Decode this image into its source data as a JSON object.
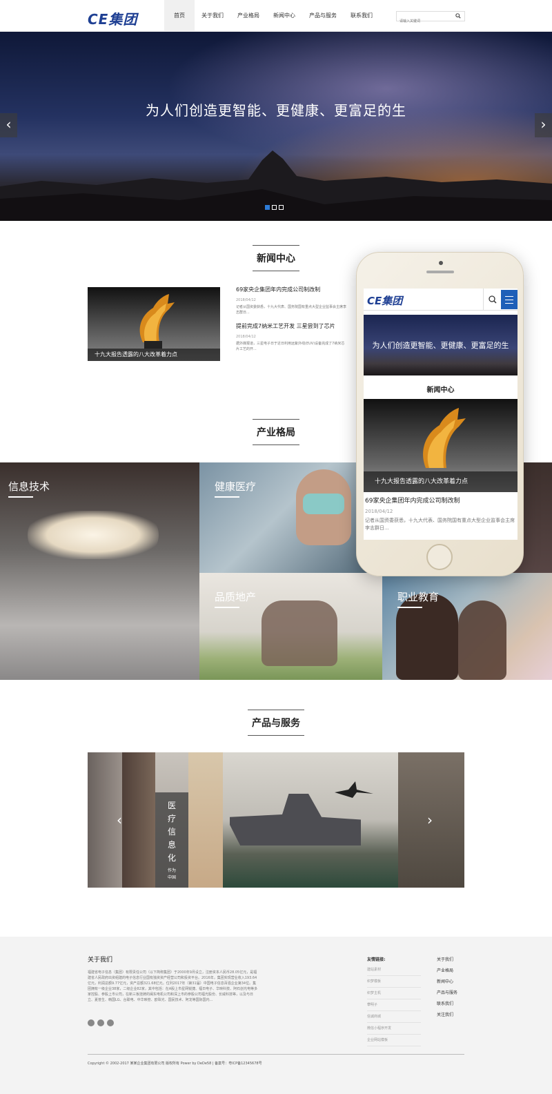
{
  "header": {
    "logo": "CE集团",
    "nav": [
      "首页",
      "关于我们",
      "产业格局",
      "新闻中心",
      "产品与服务",
      "联系我们"
    ],
    "search_placeholder": "请输入关键词"
  },
  "banner": {
    "title": "为人们创造更智能、更健康、更富足的生",
    "prev": "‹",
    "next": "›",
    "slides": 3,
    "active_slide": 1
  },
  "news": {
    "title": "新闻中心",
    "image_caption": "十九大报告透露的八大改革着力点",
    "items": [
      {
        "title": "69家央企集团年内完成公司制改制",
        "date": "2018/04/12",
        "summary": "记者从国资委获悉，十九大代表、国务院国有重点大型企业监事会主席李志群日..."
      },
      {
        "title": "提前完成7纳米工艺开发 三星尝到了芯片",
        "date": "2018/04/12",
        "summary": "据外媒报道，三星电子日于近日利用远紫外线(EUV)设备完成了7纳米芯片工艺的开..."
      }
    ]
  },
  "industry": {
    "title": "产业格局",
    "tiles": [
      "信息技术",
      "健康医疗",
      "品质地产",
      "职业教育"
    ]
  },
  "phone": {
    "logo": "CE集团",
    "banner_title": "为人们创造更智能、更健康、更富足的生",
    "section": "新闻中心",
    "caption": "十九大报告透露的八大改革着力点",
    "news_title": "69家央企集团年内完成公司制改制",
    "news_date": "2018/04/12",
    "news_summary": "记者从国资委获悉，十九大代表、国务院国有重点大型企业监事会主席李志群日..."
  },
  "products": {
    "title": "产品与服务",
    "caption_vertical": "医疗信息化",
    "caption_sub": "作为中国",
    "prev": "‹",
    "next": "›"
  },
  "footer": {
    "about_title": "关于我们",
    "about_text": "福建省电子信息（集团）有限责任公司（以下简称集团）于2000年9月设立，注册资本人民币28.05亿元，是福建省人民政府出资组建的电子信息行业国有独资资产经营公司和投资平台。2016年，集团实现营业收入193.64亿元，利润总额9.77亿元，资产总额321.68亿元。位列2017年（第31届）中国电子信息百强企业第34位。集团拥有一级企业38家，二级企业82家，其中包括：在A股上市星网锐捷、福日电子、华映科技、阿石创光电等多家控股、参股上市公司，在新三板挂牌的闽东电机公司和深上市的参股公司福光股份、长威科技等，以及与日立、夏普生、韩国LG、台联电、中华映管、欧珠光、国民技术、阿龙等国际国内...",
    "links_title": "友情链接:",
    "links": [
      "建站素材",
      "织梦模板",
      "织梦主机",
      "攀明子",
      "信诚商城",
      "微信小程序开发",
      "企业网站模板"
    ],
    "nav": [
      "关于我们",
      "产业格局",
      "新闻中心",
      "产品与服务",
      "联系我们",
      "关注我们"
    ],
    "copyright": "Copyright © 2002-2017 某某企业集团有限公司 版权所有 Power by DeDe58 | 备案号：粤ICP备12345678号"
  },
  "colors": {
    "brand": "#1e3f93",
    "accent": "#2d7bd6",
    "menu": "#1e5fb8"
  }
}
